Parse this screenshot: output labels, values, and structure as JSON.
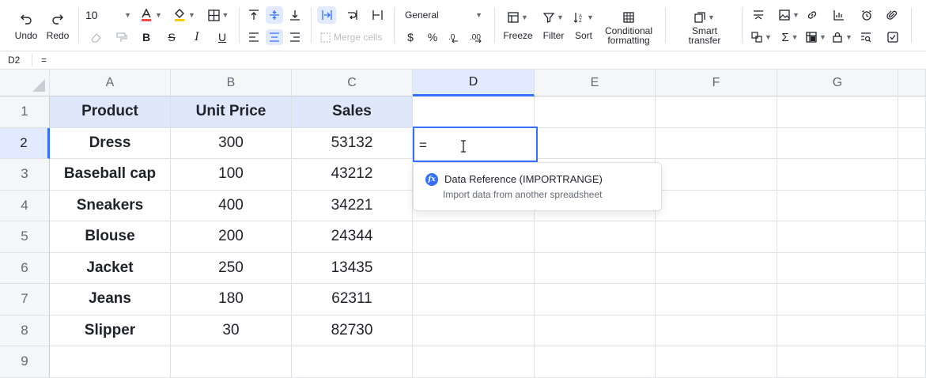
{
  "toolbar": {
    "undo_label": "Undo",
    "redo_label": "Redo",
    "font_size": "10",
    "merge_label": "Merge cells",
    "number_format": "General",
    "currency_symbol": "$",
    "percent_symbol": "%",
    "freeze_label": "Freeze",
    "filter_label": "Filter",
    "sort_label": "Sort",
    "conditional_line1": "Conditional",
    "conditional_line2": "formatting",
    "smart_line1": "Smart",
    "smart_line2": "transfer",
    "colors": {
      "text_color": "#f54a45",
      "fill_color": "#ffc60a",
      "accent": "#3370ff"
    }
  },
  "formula_bar": {
    "cell_ref": "D2",
    "value": "="
  },
  "columns": [
    "A",
    "B",
    "C",
    "D",
    "E",
    "F",
    "G"
  ],
  "rows": [
    "1",
    "2",
    "3",
    "4",
    "5",
    "6",
    "7",
    "8",
    "9"
  ],
  "table": {
    "headers": [
      "Product",
      "Unit Price",
      "Sales"
    ],
    "data": [
      [
        "Dress",
        "300",
        "53132"
      ],
      [
        "Baseball cap",
        "100",
        "43212"
      ],
      [
        "Sneakers",
        "400",
        "34221"
      ],
      [
        "Blouse",
        "200",
        "24344"
      ],
      [
        "Jacket",
        "250",
        "13435"
      ],
      [
        "Jeans",
        "180",
        "62311"
      ],
      [
        "Slipper",
        "30",
        "82730"
      ]
    ]
  },
  "editor": {
    "text": "="
  },
  "suggestion": {
    "icon": "fx-icon",
    "title": "Data Reference (IMPORTRANGE)",
    "description": "Import data from another spreadsheet"
  }
}
